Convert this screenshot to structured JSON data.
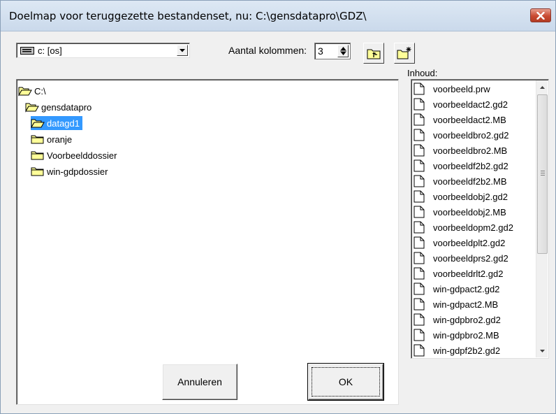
{
  "window": {
    "title": "Doelmap voor teruggezette bestandenset, nu: C:\\gensdatapro\\GDZ\\"
  },
  "toolbar": {
    "drive": {
      "selected": "c: [os]",
      "icon": "drive-icon"
    },
    "columns_label": "Aantal kolommen:",
    "columns_value": "3",
    "parent_folder_icon": "folder-up-icon",
    "new_folder_icon": "new-folder-icon"
  },
  "tree": {
    "items": [
      {
        "label": "C:\\",
        "level": 0,
        "open": true,
        "selected": false
      },
      {
        "label": "gensdatapro",
        "level": 1,
        "open": true,
        "selected": false
      },
      {
        "label": "datagd1",
        "level": 2,
        "open": true,
        "selected": true
      },
      {
        "label": "oranje",
        "level": 2,
        "open": false,
        "selected": false
      },
      {
        "label": "Voorbeelddossier",
        "level": 2,
        "open": false,
        "selected": false
      },
      {
        "label": "win-gdpdossier",
        "level": 2,
        "open": false,
        "selected": false
      }
    ]
  },
  "files": {
    "label": "Inhoud:",
    "items": [
      "voorbeeld.prw",
      "voorbeeldact2.gd2",
      "voorbeeldact2.MB",
      "voorbeeldbro2.gd2",
      "voorbeeldbro2.MB",
      "voorbeeldf2b2.gd2",
      "voorbeeldf2b2.MB",
      "voorbeeldobj2.gd2",
      "voorbeeldobj2.MB",
      "voorbeeldopm2.gd2",
      "voorbeeldplt2.gd2",
      "voorbeeldprs2.gd2",
      "voorbeeldrlt2.gd2",
      "win-gdpact2.gd2",
      "win-gdpact2.MB",
      "win-gdpbro2.gd2",
      "win-gdpbro2.MB",
      "win-gdpf2b2.gd2"
    ]
  },
  "buttons": {
    "cancel": "Annuleren",
    "ok": "OK"
  },
  "colors": {
    "selection": "#3399ff",
    "folder": "#ffff99",
    "close": "#c94a32"
  }
}
